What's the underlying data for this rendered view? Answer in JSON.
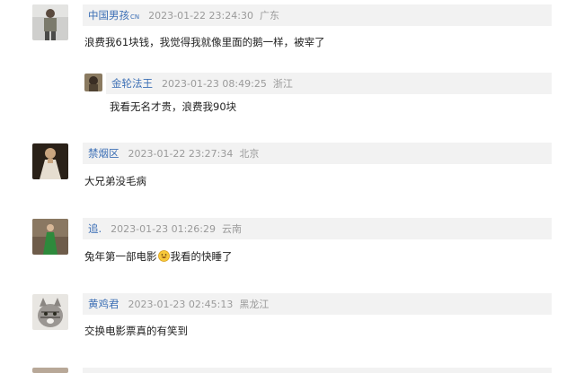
{
  "comments": [
    {
      "username": "中国男孩",
      "badge": "CN",
      "time": "2023-01-22 23:24:30",
      "location": "广东",
      "text": "浪费我61块钱，我觉得我就像里面的鹅一样，被宰了",
      "reply": {
        "username": "金轮法王",
        "time": "2023-01-23 08:49:25",
        "location": "浙江",
        "text": "我看无名才贵，浪费我90块"
      }
    },
    {
      "username": "禁烟区",
      "time": "2023-01-22 23:27:34",
      "location": "北京",
      "text": "大兄弟没毛病"
    },
    {
      "username": "追.",
      "time": "2023-01-23 01:26:29",
      "location": "云南",
      "text_before": "兔年第一部电影",
      "emoji": "grinning-face-emoji",
      "text_after": "我看的快睡了"
    },
    {
      "username": "黄鸡君",
      "time": "2023-01-23 02:45:13",
      "location": "黑龙江",
      "text": "交换电影票真的有笑到"
    }
  ]
}
